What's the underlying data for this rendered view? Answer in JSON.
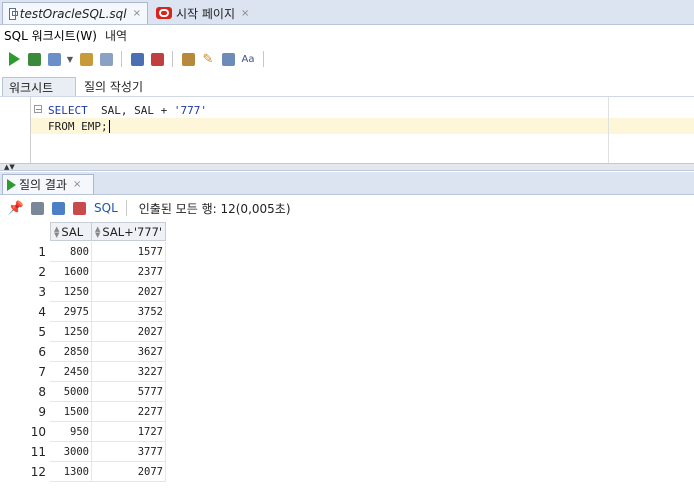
{
  "tabs": [
    {
      "title": "testOracleSQL.sql",
      "close": "×"
    },
    {
      "title": "시작 페이지",
      "close": "×"
    }
  ],
  "subtabs": {
    "worksheet": "SQL 워크시트(W)",
    "history": "내역"
  },
  "worksheet_tabs": {
    "worksheet": "워크시트",
    "query_builder": "질의 작성기"
  },
  "editor": {
    "line1_kw": "SELECT",
    "line1_rest": "  SAL, SAL + ",
    "line1_str": "'777'",
    "line2": "FROM EMP;"
  },
  "results": {
    "tab_label": "질의 결과",
    "tab_close": "×",
    "sql_label": "SQL",
    "status": "인출된 모든 행: 12(0,005초)",
    "columns": [
      "SAL",
      "SAL+'777'"
    ],
    "rows": [
      {
        "n": "1",
        "sal": "800",
        "sum": "1577"
      },
      {
        "n": "2",
        "sal": "1600",
        "sum": "2377"
      },
      {
        "n": "3",
        "sal": "1250",
        "sum": "2027"
      },
      {
        "n": "4",
        "sal": "2975",
        "sum": "3752"
      },
      {
        "n": "5",
        "sal": "1250",
        "sum": "2027"
      },
      {
        "n": "6",
        "sal": "2850",
        "sum": "3627"
      },
      {
        "n": "7",
        "sal": "2450",
        "sum": "3227"
      },
      {
        "n": "8",
        "sal": "5000",
        "sum": "5777"
      },
      {
        "n": "9",
        "sal": "1500",
        "sum": "2277"
      },
      {
        "n": "10",
        "sal": "950",
        "sum": "1727"
      },
      {
        "n": "11",
        "sal": "3000",
        "sum": "3777"
      },
      {
        "n": "12",
        "sal": "1300",
        "sum": "2077"
      }
    ]
  },
  "colors": {
    "keyword": "#1c3aa8",
    "run": "#2e9b2e",
    "oracle_red": "#d9241b"
  }
}
